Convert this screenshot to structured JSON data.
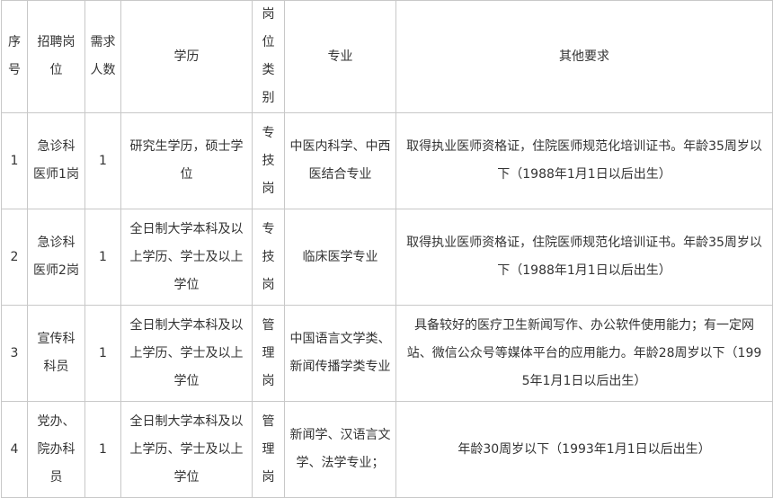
{
  "table": {
    "headers": [
      "序号",
      "招聘岗位",
      "需求人数",
      "学历",
      "岗位类别",
      "专业",
      "其他要求"
    ],
    "rows": [
      {
        "no": "1",
        "position": "急诊科医师1岗",
        "count": "1",
        "education": "研究生学历，硕士学位",
        "category": "专技岗",
        "major": "中医内科学、中西医结合专业",
        "requirements": "取得执业医师资格证，住院医师规范化培训证书。年龄35周岁以下（1988年1月1日以后出生）"
      },
      {
        "no": "2",
        "position": "急诊科医师2岗",
        "count": "1",
        "education": "全日制大学本科及以上学历、学士及以上学位",
        "category": "专技岗",
        "major": "临床医学专业",
        "requirements": "取得执业医师资格证，住院医师规范化培训证书。年龄35周岁以下（1988年1月1日以后出生）"
      },
      {
        "no": "3",
        "position": "宣传科科员",
        "count": "1",
        "education": "全日制大学本科及以上学历、学士及以上学位",
        "category": "管理岗",
        "major": "中国语言文学类、新闻传播学类专业",
        "requirements": "具备较好的医疗卫生新闻写作、办公软件使用能力；有一定网站、微信公众号等媒体平台的应用能力。年龄28周岁以下（1995年1月1日以后出生）"
      },
      {
        "no": "4",
        "position": "党办、院办科员",
        "count": "1",
        "education": "全日制大学本科及以上学历、学士及以上学位",
        "category": "管理岗",
        "major": "新闻学、汉语言文学、法学专业；",
        "requirements": "年龄30周岁以下（1993年1月1日以后出生）"
      }
    ]
  }
}
